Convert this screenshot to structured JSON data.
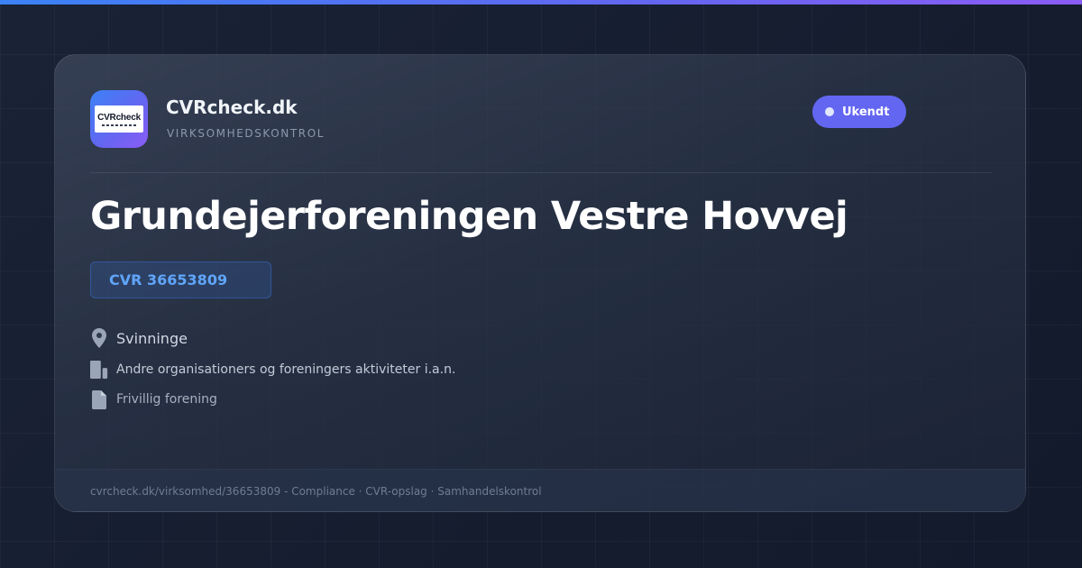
{
  "brand": {
    "logo_text": "CVRcheck",
    "name": "CVRcheck.dk",
    "tagline": "VIRKSOMHEDSKONTROL"
  },
  "status": {
    "label": "Ukendt",
    "color": "#6366f1"
  },
  "company": {
    "name": "Grundejerforeningen Vestre Hovvej",
    "cvr": "CVR 36653809",
    "location": "Svinninge",
    "industry": "Andre organisationers og foreningers aktiviteter i.a.n.",
    "legal_form": "Frivillig forening"
  },
  "footer": {
    "text": "cvrcheck.dk/virksomhed/36653809 - Compliance · CVR-opslag · Samhandelskontrol"
  },
  "icons": {
    "location": "map-pin-icon",
    "industry": "building-icon",
    "legal_form": "document-icon"
  },
  "colors": {
    "accent_blue": "#3b82f6",
    "accent_indigo": "#6366f1",
    "accent_violet": "#8b5cf6",
    "cvr_text": "#60a5fa",
    "background": "#141c2e"
  }
}
